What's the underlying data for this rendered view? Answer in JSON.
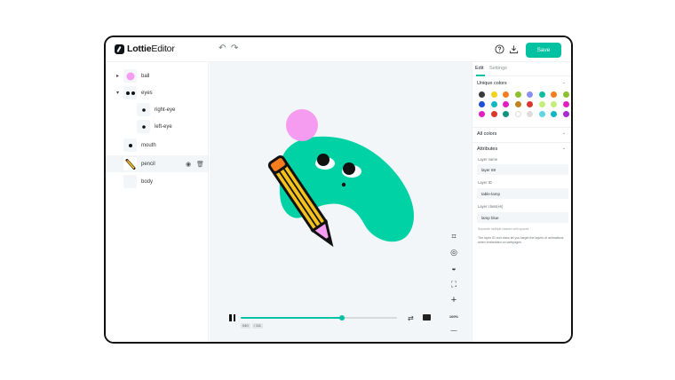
{
  "header": {
    "logo_bold": "Lottie",
    "logo_light": "Editor",
    "undo_glyph": "↶",
    "redo_glyph": "↷",
    "save_label": "Save"
  },
  "layers": [
    {
      "label": "ball",
      "expanded": false,
      "has_caret": true
    },
    {
      "label": "eyes",
      "expanded": true,
      "has_caret": true
    },
    {
      "label": "right-eye"
    },
    {
      "label": "left-eye"
    },
    {
      "label": "mouth"
    },
    {
      "label": "pencil",
      "selected": true
    },
    {
      "label": "body"
    }
  ],
  "layer_glyphs": {
    "collapsed": "▸",
    "expanded": "▾",
    "eye": "◉",
    "trash": "🗑"
  },
  "tools": {
    "zoom_label": "100%",
    "plus": "+",
    "minus": "—",
    "glyphs": [
      "⌗",
      "◎",
      "◒",
      "⛶"
    ]
  },
  "player": {
    "progress": 0.65,
    "frame_current": "040",
    "frame_total": "/ 111",
    "loop_glyph": "⇄"
  },
  "props": {
    "tabs": [
      "Edit",
      "Settings"
    ],
    "active_tab": "Edit",
    "unique_colors_title": "Unique colors",
    "swatches": [
      "#3a3a3a",
      "#f2d21b",
      "#f57c1f",
      "#8bc12b",
      "#8d8ff0",
      "#11bda0",
      "#f57c1f",
      "#8bc12b",
      "#1e4fd6",
      "#11b8c2",
      "#e31fc3",
      "#c0831f",
      "#d9372b",
      "#c6ec7a",
      "#c6ec7a",
      "#e31fc3",
      "#e31fc3",
      "#d9372b",
      "#11947d",
      "#ffffff",
      "#dddddd",
      "#5fd6e0",
      "#11b8c2",
      "#a92bd6"
    ],
    "all_colors_title": "All colors",
    "attributes_title": "Attributes",
    "layer_name_label": "Layer name",
    "layer_name_value": "layer 69",
    "layer_id_label": "Layer ID",
    "layer_id_value": "table-lamp",
    "layer_classes_label": "Layer class(es)",
    "layer_classes_value": "lamp blue",
    "hint": "Separate multiple classes with spaces",
    "note": "The layer ID and class let you target the layers of animations when embedded on webpages",
    "chevron_glyph": "⌄"
  }
}
